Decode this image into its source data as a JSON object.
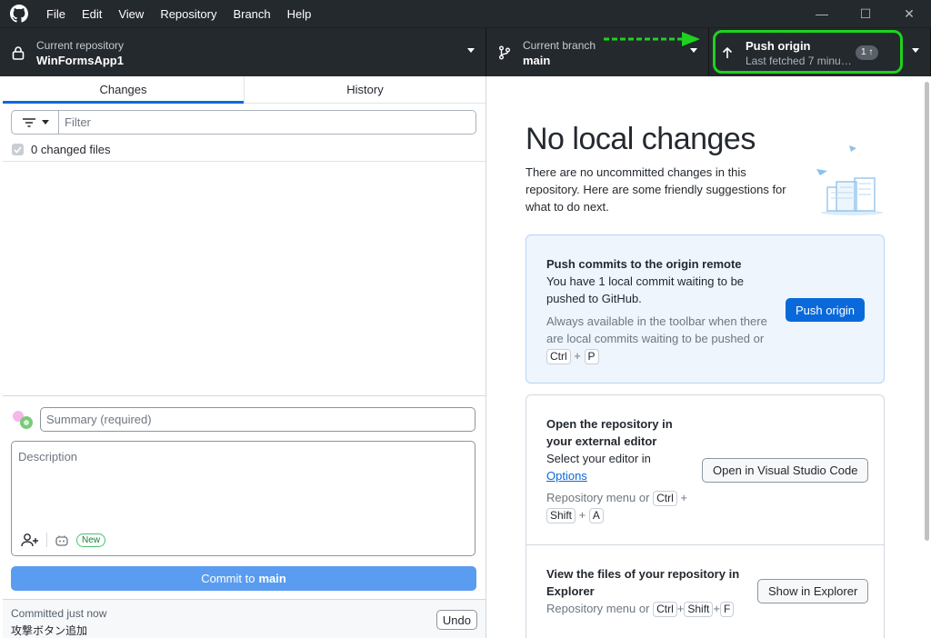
{
  "menu": {
    "items": [
      "File",
      "Edit",
      "View",
      "Repository",
      "Branch",
      "Help"
    ]
  },
  "window": {
    "minimize": "—",
    "maximize": "☐",
    "close": "✕"
  },
  "toolbar": {
    "repo_label": "Current repository",
    "repo_value": "WinFormsApp1",
    "branch_label": "Current branch",
    "branch_value": "main",
    "push_title": "Push origin",
    "push_sub": "Last fetched 7 minu…",
    "push_count": "1 ↑",
    "highlight_color": "#1ed21e"
  },
  "left": {
    "tabs": [
      "Changes",
      "History"
    ],
    "active_tab": "Changes",
    "filter_placeholder": "Filter",
    "changed_files": "0 changed files",
    "summary_placeholder": "Summary (required)",
    "description_placeholder": "Description",
    "new_badge": "New",
    "commit_prefix": "Commit to",
    "commit_branch": "main",
    "last_commit_time": "Committed just now",
    "last_commit_message": "攻撃ボタン追加",
    "undo": "Undo"
  },
  "right": {
    "title": "No local changes",
    "description": "There are no uncommitted changes in this repository. Here are some friendly suggestions for what to do next.",
    "push_card": {
      "title": "Push commits to the origin remote",
      "body": "You have 1 local commit waiting to be pushed to GitHub.",
      "hint": "Always available in the toolbar when there are local commits waiting to be pushed or",
      "keys": [
        "Ctrl",
        "P"
      ],
      "button": "Push origin"
    },
    "editor_card": {
      "title": "Open the repository in your external editor",
      "body": "Select your editor in",
      "link": "Options",
      "hint": "Repository menu or",
      "keys": [
        "Ctrl",
        "Shift",
        "A"
      ],
      "button": "Open in Visual Studio Code"
    },
    "explorer_card": {
      "title": "View the files of your repository in Explorer",
      "hint": "Repository menu or",
      "keys": [
        "Ctrl",
        "Shift",
        "F"
      ],
      "button": "Show in Explorer"
    }
  },
  "colors": {
    "toolbar_bg": "#24292e",
    "accent": "#0969da",
    "commit_button": "#5a9cf0"
  }
}
